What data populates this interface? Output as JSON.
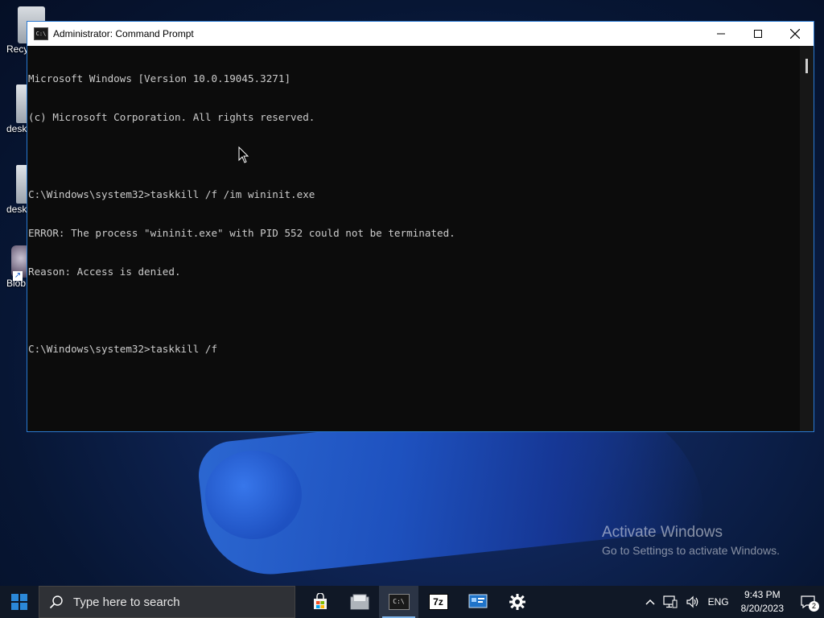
{
  "desktop": {
    "icons": [
      {
        "label": "Recy"
      },
      {
        "label": "desk"
      },
      {
        "label": "desk"
      },
      {
        "label": "Blob"
      }
    ]
  },
  "window": {
    "title": "Administrator:  Command Prompt",
    "title_icon_text": "C:\\",
    "minimize_glyph": "—",
    "maximize_glyph": "☐",
    "close_glyph": "✕"
  },
  "console": {
    "lines": [
      "Microsoft Windows [Version 10.0.19045.3271]",
      "(c) Microsoft Corporation. All rights reserved.",
      "",
      "C:\\Windows\\system32>taskkill /f /im wininit.exe",
      "ERROR: The process \"wininit.exe\" with PID 552 could not be terminated.",
      "Reason: Access is denied.",
      "",
      "C:\\Windows\\system32>taskkill /f"
    ]
  },
  "watermark": {
    "title": "Activate Windows",
    "subtitle": "Go to Settings to activate Windows."
  },
  "taskbar": {
    "search_placeholder": "Type here to search",
    "apps": [
      {
        "name": "microsoft-store",
        "icon": "store-icon"
      },
      {
        "name": "file-explorer",
        "icon": "folder-icon"
      },
      {
        "name": "command-prompt",
        "icon": "cmd-icon",
        "label": "C:\\",
        "active": true
      },
      {
        "name": "7zip",
        "icon": "7zip-icon",
        "label": "7z"
      },
      {
        "name": "control-panel",
        "icon": "control-panel-icon"
      },
      {
        "name": "settings",
        "icon": "gear-icon"
      }
    ],
    "tray": {
      "language": "ENG",
      "time": "9:43 PM",
      "date": "8/20/2023",
      "notification_count": "2"
    }
  },
  "colors": {
    "accent": "#2a79d1",
    "console_bg": "#0c0c0c",
    "console_text": "#cccccc",
    "taskbar_bg": "#101826"
  }
}
